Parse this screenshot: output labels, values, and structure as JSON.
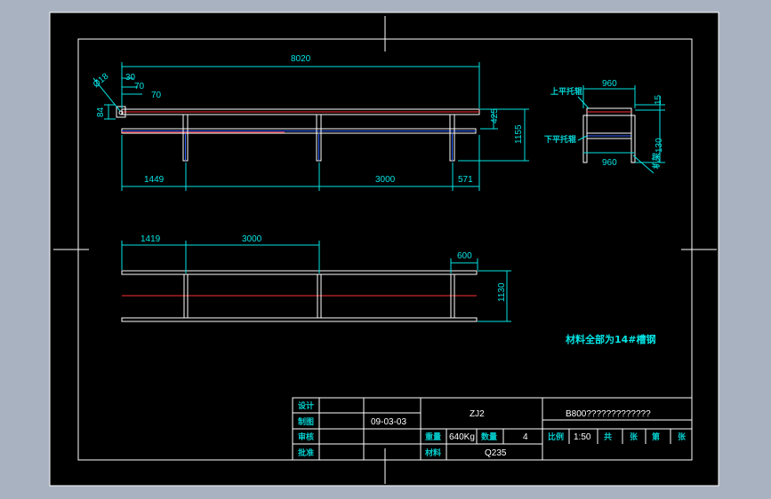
{
  "drawing": {
    "dimensions": {
      "overall_length": "8020",
      "diameter": "Ø18",
      "d30": "30",
      "d70a": "70",
      "d70b": "70",
      "d84": "84",
      "h425": "425",
      "h1155": "1155",
      "d1449": "1449",
      "d3000": "3000",
      "d571": "571",
      "p1419": "1419",
      "p3000": "3000",
      "p600": "600",
      "p1130": "1130",
      "s960_top": "960",
      "s960_bot": "960",
      "s15": "15",
      "s130": "130"
    },
    "side_labels": {
      "upper_roller": "上平托辊",
      "lower_roller": "下平托辊",
      "frame": "机架"
    },
    "material_note": "材料全部为14#槽钢"
  },
  "title_block": {
    "labels": {
      "design": "设计",
      "draw": "制图",
      "review": "审核",
      "approve": "批准",
      "unit_weight": "重量",
      "quantity": "数量",
      "material": "材料",
      "scale": "比例",
      "sheet_total": "共",
      "sheet_word": "张",
      "sheet_no": "第",
      "sheet_word2": "张"
    },
    "date": "09-03-03",
    "drawing_no": "ZJ2",
    "title": "B800?????????????",
    "weight": "640Kg",
    "quantity_value": "4",
    "scale_value": "1:50",
    "material_value": "Q235"
  }
}
